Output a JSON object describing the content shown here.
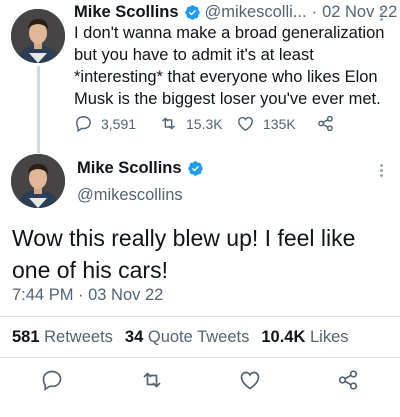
{
  "reply_tweet": {
    "author_name": "Mike Scollins",
    "handle": "@mikescolli...",
    "separator": "·",
    "date": "02 Nov 22",
    "text": "I don't wanna make a broad generalization but you have to admit it's at least *interesting* that everyone who likes Elon Musk is the biggest loser you've ever met.",
    "replies": "3,591",
    "retweets": "15.3K",
    "likes": "135K"
  },
  "main_tweet": {
    "author_name": "Mike Scollins",
    "handle": "@mikescollins",
    "text": "Wow this really blew up! I feel like one of his cars!",
    "timestamp": "7:44 PM · 03 Nov 22"
  },
  "stats": {
    "retweets_count": "581",
    "retweets_label": "Retweets",
    "quote_count": "34",
    "quote_label": "Quote Tweets",
    "likes_count": "10.4K",
    "likes_label": "Likes"
  },
  "icons": {
    "verified": "verified-badge-icon",
    "reply": "reply-bubble-icon",
    "retweet": "retweet-arrows-icon",
    "like": "heart-icon",
    "share": "share-icon",
    "more": "more-vertical-icon"
  },
  "colors": {
    "verified": "#1d9bf0",
    "text": "#0f1419",
    "muted": "#536471",
    "divider": "#dde3e7"
  }
}
